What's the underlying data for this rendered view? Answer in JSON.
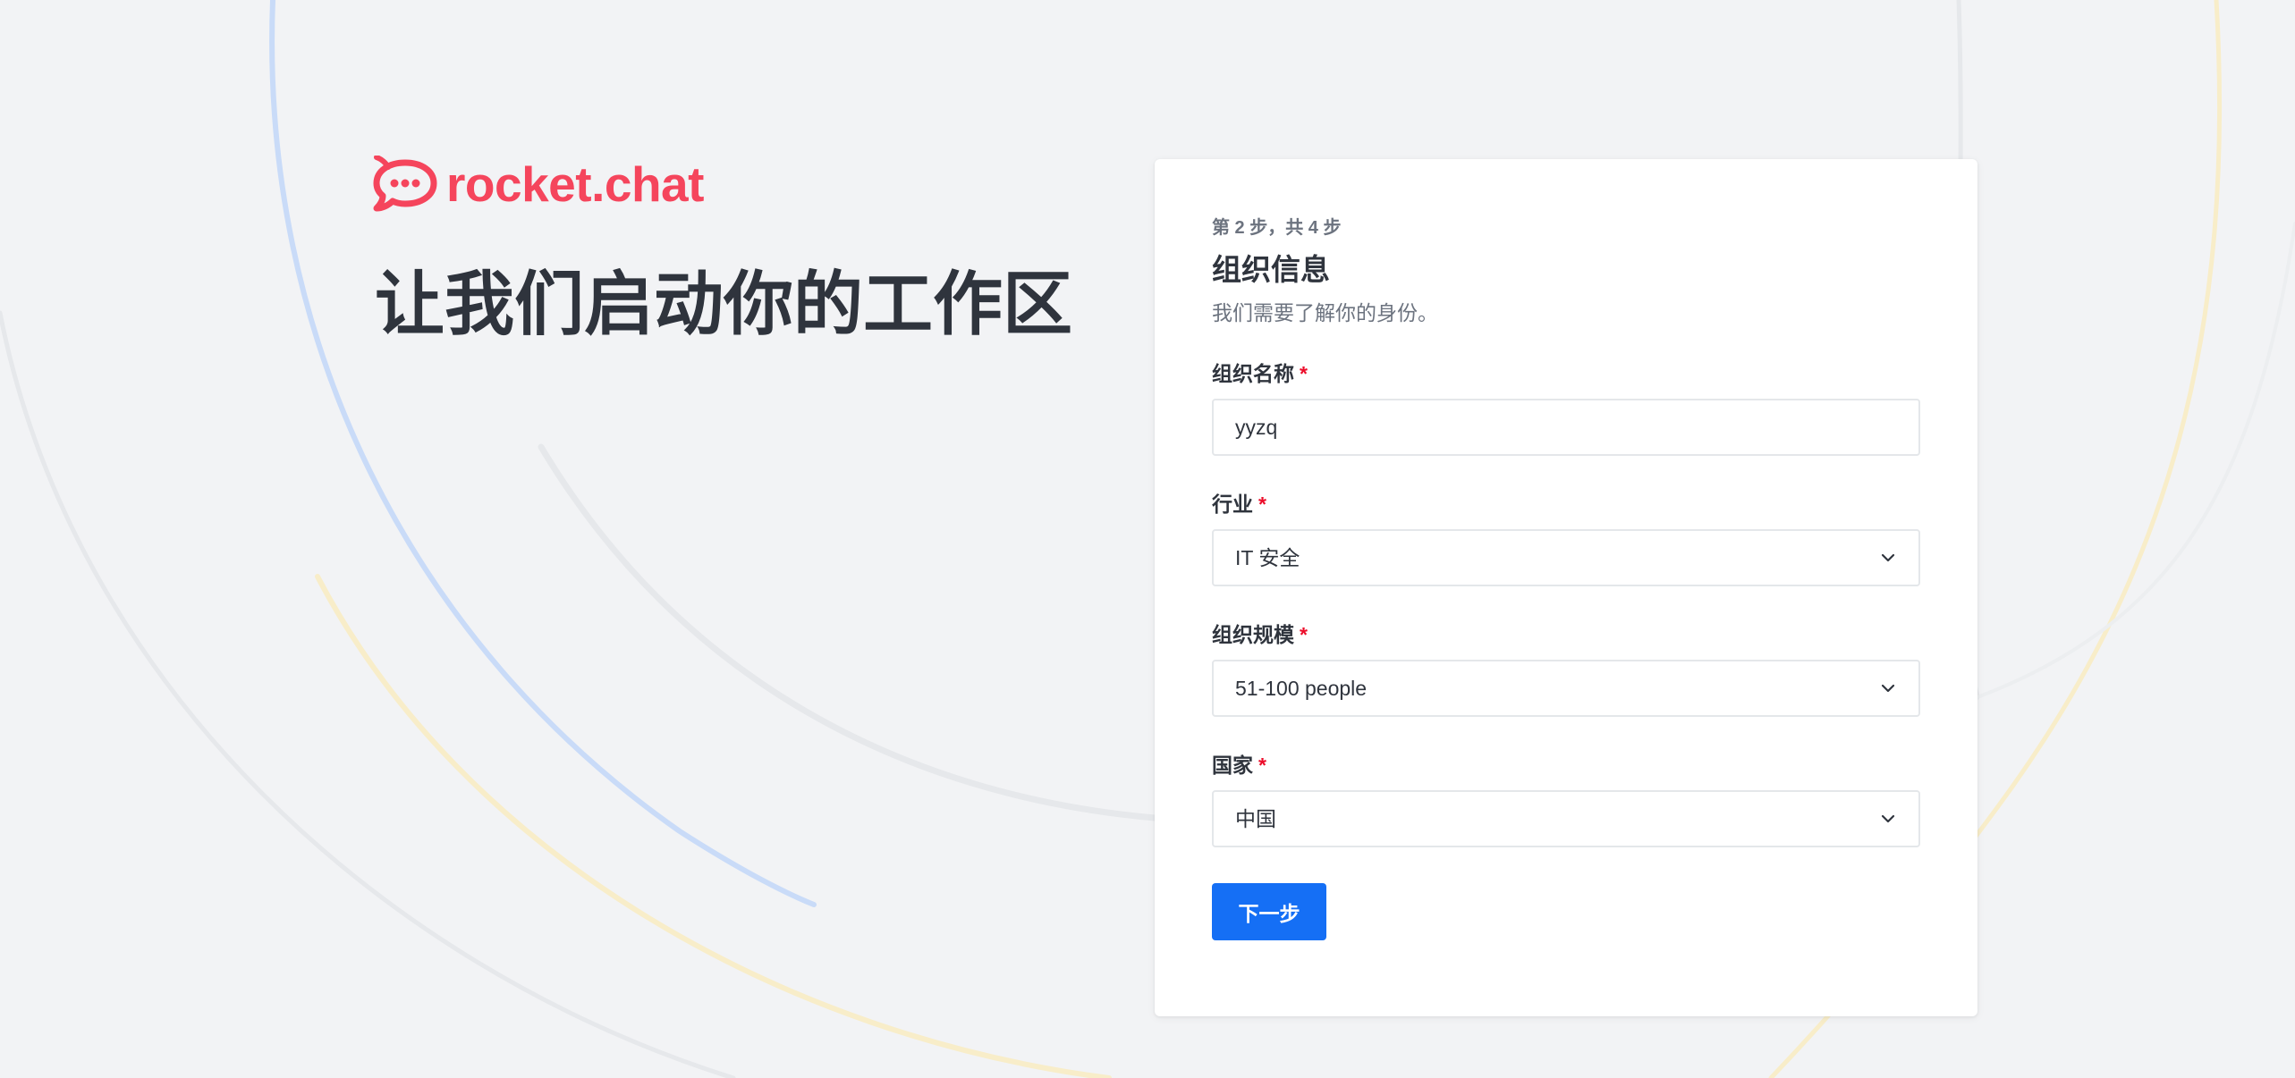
{
  "brand": {
    "wordmark": "rocket.chat",
    "logo_icon": "rocket-chat-bubble-icon",
    "color": "#f5455c"
  },
  "hero": {
    "title": "让我们启动你的工作区"
  },
  "form": {
    "step": "第 2 步，共 4 步",
    "title": "组织信息",
    "subtitle": "我们需要了解你的身份。",
    "required_marker": "*",
    "fields": [
      {
        "label": "组织名称",
        "type": "text",
        "value": "yyzq"
      },
      {
        "label": "行业",
        "type": "select",
        "value": "IT 安全",
        "icon": "chevron-down-icon"
      },
      {
        "label": "组织规模",
        "type": "select",
        "value": "51-100 people",
        "icon": "chevron-down-icon"
      },
      {
        "label": "国家",
        "type": "select",
        "value": "中国",
        "icon": "chevron-down-icon"
      }
    ],
    "next_button": "下一步"
  },
  "colors": {
    "background": "#f2f3f5",
    "card": "#ffffff",
    "primary_button": "#156ff5",
    "required": "#ec0d2a",
    "text": "#2f343d",
    "muted_text": "#6c737f",
    "input_border": "#e4e7ea",
    "decor_blue": "#c9dbf8",
    "decor_yellow": "#f8edc9",
    "decor_gray": "#e6e8eb"
  }
}
